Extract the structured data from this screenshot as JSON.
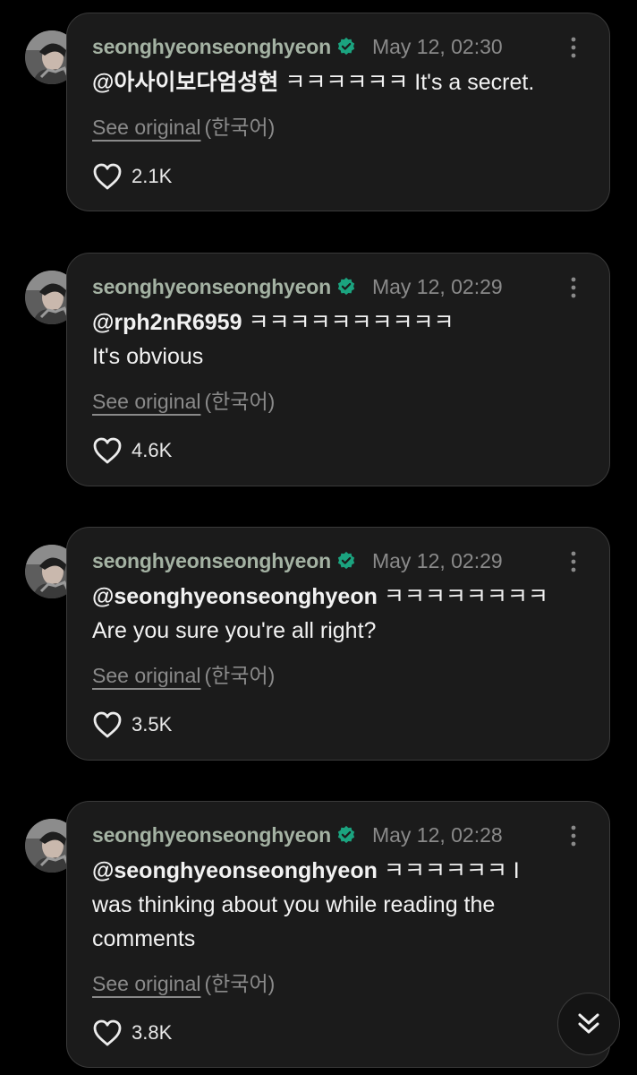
{
  "colors": {
    "background": "#000000",
    "card": "#1b1b1b",
    "username": "#a4b2a3",
    "verified_badge": "#1ba37f",
    "muted": "#8a8a8a"
  },
  "comments": [
    {
      "username": "seonghyeonseonghyeon",
      "timestamp": "May 12, 02:30",
      "mention": "@아사이보다엄성현",
      "text_inline": " ㅋㅋㅋㅋㅋㅋ It's a secret.",
      "text_rest": "",
      "see_original": "See original",
      "language": "(한국어)",
      "likes": "2.1K",
      "icons": [
        "avatar",
        "verified-badge-icon",
        "more-options-icon",
        "heart-icon"
      ]
    },
    {
      "username": "seonghyeonseonghyeon",
      "timestamp": "May 12, 02:29",
      "mention": "@rph2nR6959",
      "text_inline": " ㅋㅋㅋㅋㅋㅋㅋㅋㅋㅋ",
      "text_rest": "It's obvious",
      "see_original": "See original",
      "language": "(한국어)",
      "likes": "4.6K",
      "icons": [
        "avatar",
        "verified-badge-icon",
        "more-options-icon",
        "heart-icon"
      ]
    },
    {
      "username": "seonghyeonseonghyeon",
      "timestamp": "May 12, 02:29",
      "mention": "@seonghyeonseonghyeon",
      "text_inline": " ㅋㅋㅋㅋㅋㅋㅋㅋ",
      "text_rest": "Are you sure you're all right?",
      "see_original": "See original",
      "language": "(한국어)",
      "likes": "3.5K",
      "icons": [
        "avatar",
        "verified-badge-icon",
        "more-options-icon",
        "heart-icon"
      ]
    },
    {
      "username": "seonghyeonseonghyeon",
      "timestamp": "May 12, 02:28",
      "mention": "@seonghyeonseonghyeon",
      "text_inline": " ㅋㅋㅋㅋㅋㅋ I",
      "text_rest": "was thinking about you while reading the comments",
      "see_original": "See original",
      "language": "(한국어)",
      "likes": "3.8K",
      "icons": [
        "avatar",
        "verified-badge-icon",
        "more-options-icon",
        "heart-icon"
      ]
    }
  ],
  "scroll_button": {
    "icon": "double-chevron-down-icon"
  }
}
